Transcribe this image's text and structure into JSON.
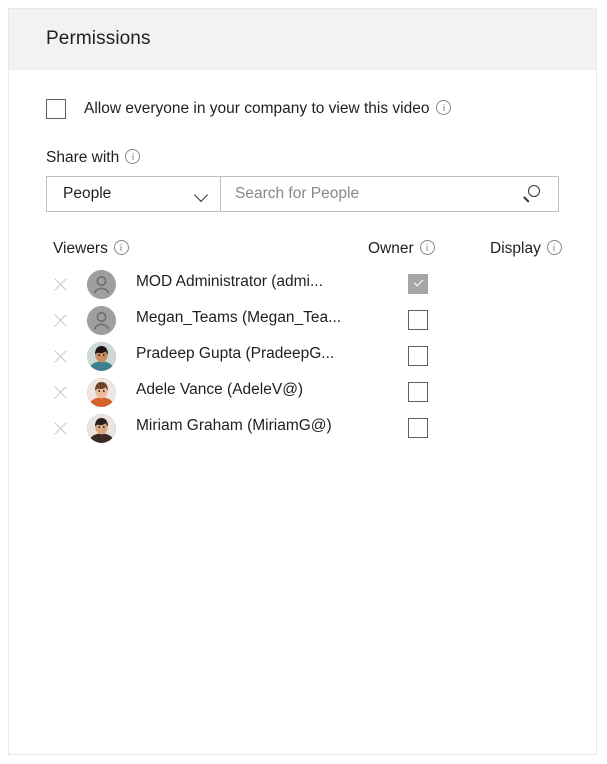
{
  "panel": {
    "title": "Permissions"
  },
  "allow_everyone": {
    "label": "Allow everyone in your company to view this video",
    "checked": false,
    "info_icon": "info-icon"
  },
  "share_with": {
    "label": "Share with",
    "info_icon": "info-icon",
    "dropdown": {
      "selected": "People",
      "chevron_icon": "chevron-down-icon"
    },
    "search": {
      "value": "",
      "placeholder": "Search for People",
      "icon": "search-icon"
    }
  },
  "table": {
    "headers": {
      "viewers": "Viewers",
      "owner": "Owner",
      "display": "Display"
    },
    "rows": [
      {
        "name": "MOD Administrator (admi...",
        "avatar_type": "generic",
        "avatar_color": "#a19f9d",
        "owner_checked": true,
        "owner_disabled": true,
        "delete_icon": "close-icon"
      },
      {
        "name": "Megan_Teams (Megan_Tea...",
        "avatar_type": "generic",
        "avatar_color": "#a19f9d",
        "owner_checked": false,
        "owner_disabled": false,
        "delete_icon": "close-icon"
      },
      {
        "name": "Pradeep Gupta (PradeepG...",
        "avatar_type": "photo",
        "avatar_color": "#3d7f8c",
        "owner_checked": false,
        "owner_disabled": false,
        "delete_icon": "close-icon"
      },
      {
        "name": "Adele Vance (AdeleV@)",
        "avatar_type": "photo",
        "avatar_color": "#d4622a",
        "owner_checked": false,
        "owner_disabled": false,
        "delete_icon": "close-icon"
      },
      {
        "name": "Miriam Graham (MiriamG@)",
        "avatar_type": "photo",
        "avatar_color": "#3a2a26",
        "owner_checked": false,
        "owner_disabled": false,
        "delete_icon": "close-icon"
      }
    ]
  },
  "colors": {
    "header_bg": "#f3f2f1",
    "panel_border": "#e8e8e8",
    "text": "#201f1e",
    "muted": "#8a8886",
    "checkbox_border": "#605e5c",
    "disabled_fill": "#a6a6a6"
  }
}
